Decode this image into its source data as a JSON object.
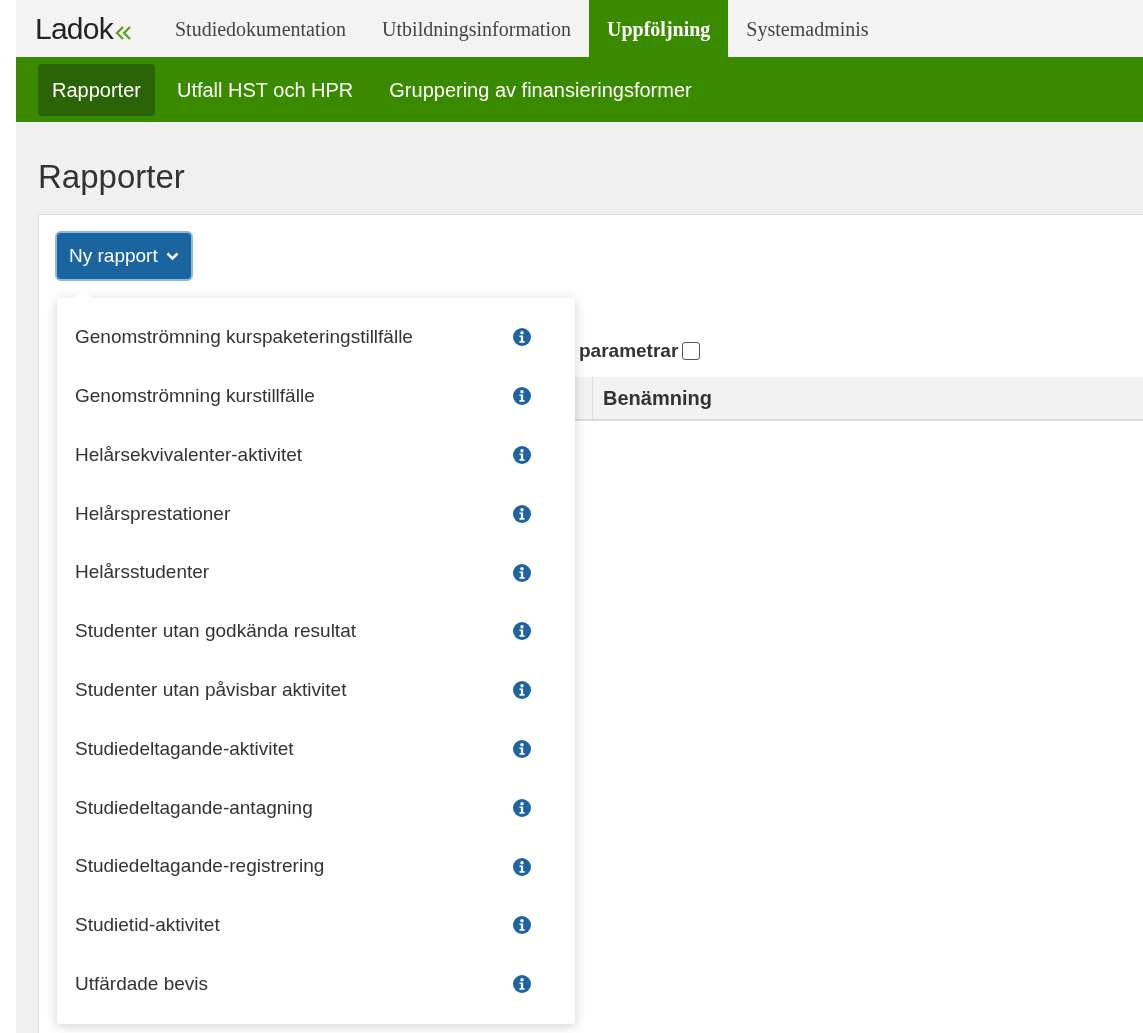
{
  "logo": {
    "text": "Ladok"
  },
  "top_tabs": [
    {
      "label": "Studiedokumentation",
      "selected": false
    },
    {
      "label": "Utbildningsinformation",
      "selected": false
    },
    {
      "label": "Uppföljning",
      "selected": true
    },
    {
      "label": "Systemadminis",
      "selected": false
    }
  ],
  "sub_tabs": [
    {
      "label": "Rapporter",
      "selected": true
    },
    {
      "label": "Utfall HST och HPR",
      "selected": false
    },
    {
      "label": "Gruppering av finansieringsformer",
      "selected": false
    }
  ],
  "page_title": "Rapporter",
  "new_report_button": {
    "label": "Ny rapport",
    "expanded": true
  },
  "dropdown_items": [
    "Genomströmning kurspaketeringstillfälle",
    "Genomströmning kurstillfälle",
    "Helårsekvivalenter-aktivitet",
    "Helårsprestationer",
    "Helårsstudenter",
    "Studenter utan godkända resultat",
    "Studenter utan påvisbar aktivitet",
    "Studiedeltagande-aktivitet",
    "Studiedeltagande-antagning",
    "Studiedeltagande-registrering",
    "Studietid-aktivitet",
    "Utfärdade bevis"
  ],
  "parameters_option": {
    "label": "parametrar",
    "checked": false
  },
  "table": {
    "columns": [
      "Benämning"
    ]
  }
}
